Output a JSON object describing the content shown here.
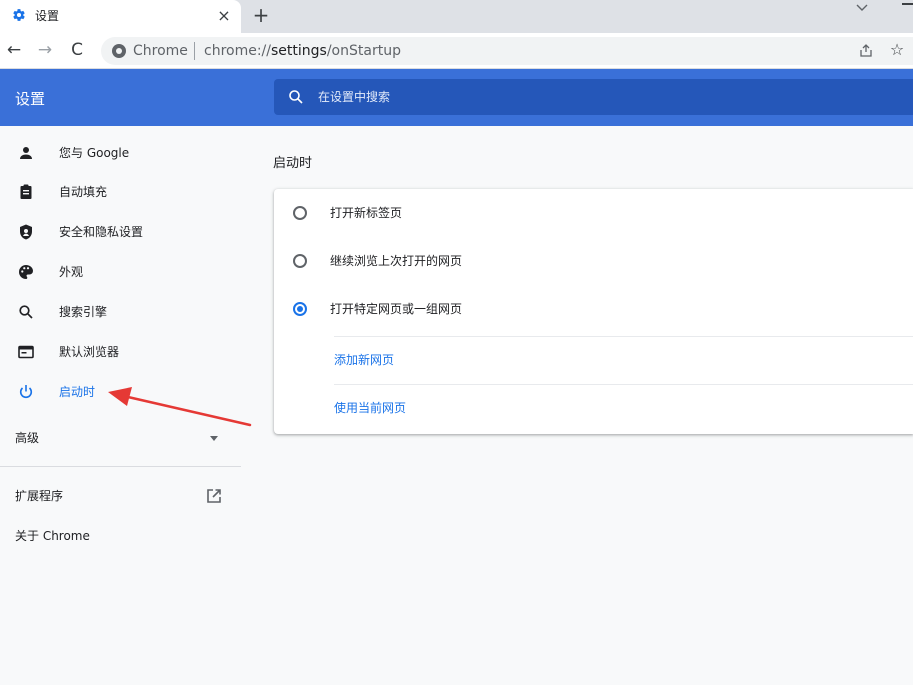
{
  "tab": {
    "title": "设置",
    "icon": "gear-icon",
    "close": "×",
    "new_tab": "+"
  },
  "toolbar": {
    "back": "←",
    "forward": "→",
    "reload": "C",
    "site_name": "Chrome",
    "url_prefix": "chrome://",
    "url_host": "settings",
    "url_path": "/onStartup",
    "star": "☆"
  },
  "header": {
    "title": "设置",
    "search_placeholder": "在设置中搜索"
  },
  "sidebar": {
    "items": [
      {
        "label": "您与 Google",
        "icon": "person-icon",
        "active": false
      },
      {
        "label": "自动填充",
        "icon": "clipboard-icon",
        "active": false
      },
      {
        "label": "安全和隐私设置",
        "icon": "shield-icon",
        "active": false
      },
      {
        "label": "外观",
        "icon": "palette-icon",
        "active": false
      },
      {
        "label": "搜索引擎",
        "icon": "search-icon",
        "active": false
      },
      {
        "label": "默认浏览器",
        "icon": "browser-window-icon",
        "active": false
      },
      {
        "label": "启动时",
        "icon": "power-icon",
        "active": true
      }
    ],
    "advanced": "高级",
    "extensions": "扩展程序",
    "about": "关于 Chrome"
  },
  "main": {
    "section_title": "启动时",
    "options": [
      {
        "label": "打开新标签页",
        "checked": false
      },
      {
        "label": "继续浏览上次打开的网页",
        "checked": false
      },
      {
        "label": "打开特定网页或一组网页",
        "checked": true
      }
    ],
    "links": [
      {
        "label": "添加新网页"
      },
      {
        "label": "使用当前网页"
      }
    ]
  },
  "colors": {
    "header_bg": "#3a70d8",
    "search_bg": "#2557b9",
    "accent": "#1a73e8",
    "annotation": "#e53935"
  }
}
